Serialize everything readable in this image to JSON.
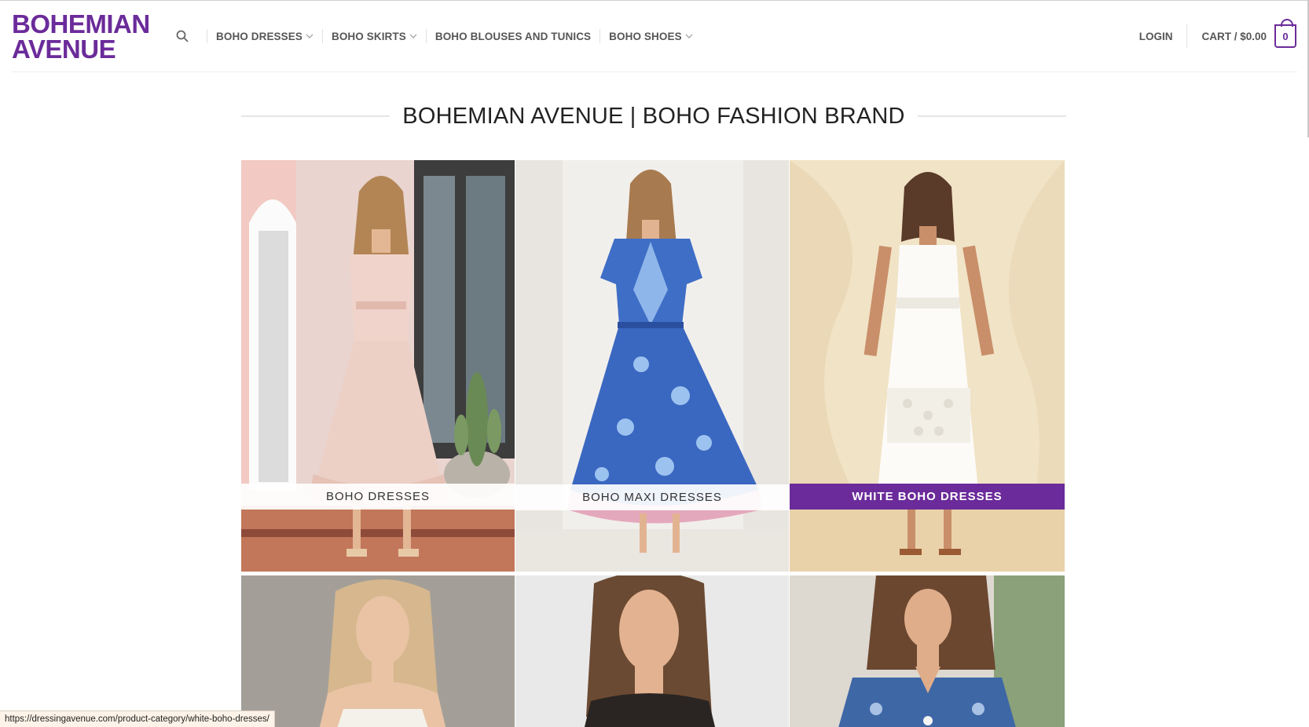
{
  "brand": {
    "line1": "BOHEMIAN",
    "line2": "AVENUE",
    "color": "#6b2b9a"
  },
  "nav": {
    "search_icon": "search-icon",
    "items": [
      {
        "label": "BOHO DRESSES",
        "has_dropdown": true
      },
      {
        "label": "BOHO SKIRTS",
        "has_dropdown": true
      },
      {
        "label": "BOHO BLOUSES AND TUNICS",
        "has_dropdown": false
      },
      {
        "label": "BOHO SHOES",
        "has_dropdown": true
      }
    ]
  },
  "account": {
    "login_label": "LOGIN",
    "cart_label": "CART / $0.00",
    "cart_count": "0"
  },
  "page": {
    "heading": "BOHEMIAN AVENUE | BOHO FASHION BRAND"
  },
  "categories": [
    {
      "label": "BOHO DRESSES",
      "active": false
    },
    {
      "label": "BOHO MAXI DRESSES",
      "active": false
    },
    {
      "label": "WHITE BOHO DRESSES",
      "active": true
    }
  ],
  "status_bar": {
    "url": "https://dressingavenue.com/product-category/white-boho-dresses/"
  },
  "colors": {
    "accent": "#6b2b9a",
    "text": "#565656"
  }
}
